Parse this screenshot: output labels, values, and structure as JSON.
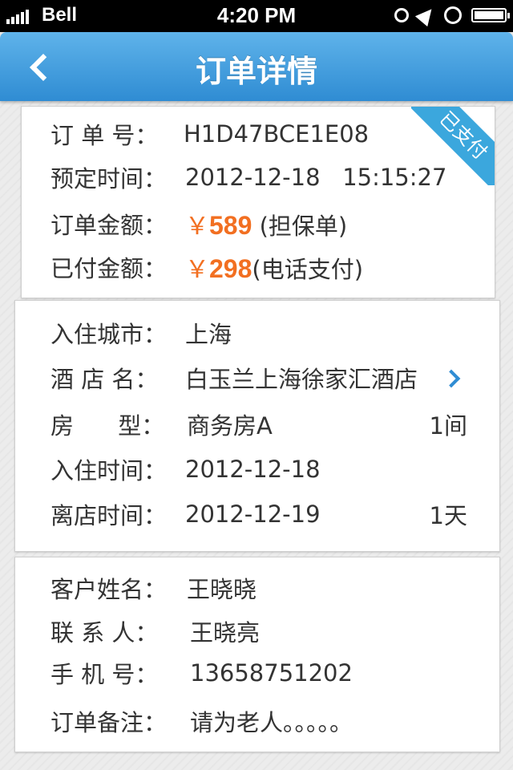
{
  "status_bar": {
    "carrier": "Bell",
    "time": "4:20 PM"
  },
  "nav": {
    "title": "订单详情"
  },
  "order": {
    "order_no_label": "订 单 号：",
    "order_no": "H1D47BCE1E08",
    "book_time_label": "预定时间：",
    "book_time": "2012-12-18   15:15:27",
    "amount_label": "订单金额：",
    "amount_symbol": "￥",
    "amount": "589",
    "amount_note": "(担保单)",
    "paid_label": "已付金额：",
    "paid_symbol": "￥",
    "paid_amount": "298",
    "paid_note": "(电话支付)",
    "status_badge": "已支付"
  },
  "hotel": {
    "city_label": "入住城市：",
    "city": "上海",
    "hotel_label": "酒 店 名：",
    "hotel_name": "白玉兰上海徐家汇酒店",
    "room_label": "房      型：",
    "room_type": "商务房A",
    "room_count": "1间",
    "checkin_label": "入住时间：",
    "checkin": "2012-12-18",
    "checkout_label": "离店时间：",
    "checkout": "2012-12-19",
    "nights": "1天"
  },
  "guest": {
    "name_label": "客户姓名：",
    "name": "王晓晓",
    "contact_label": "联 系 人：",
    "contact": "王晓亮",
    "phone_label": "手 机 号：",
    "phone": "13658751202",
    "remark_label": "订单备注：",
    "remark": "请为老人。。。。。"
  },
  "colors": {
    "nav": "#3a97dc",
    "price": "#f26f21",
    "badge": "#3ba7dd"
  },
  "icons": [
    "back-icon",
    "chevron-right-icon",
    "alarm-icon",
    "location-icon",
    "lock-icon",
    "battery-icon"
  ]
}
